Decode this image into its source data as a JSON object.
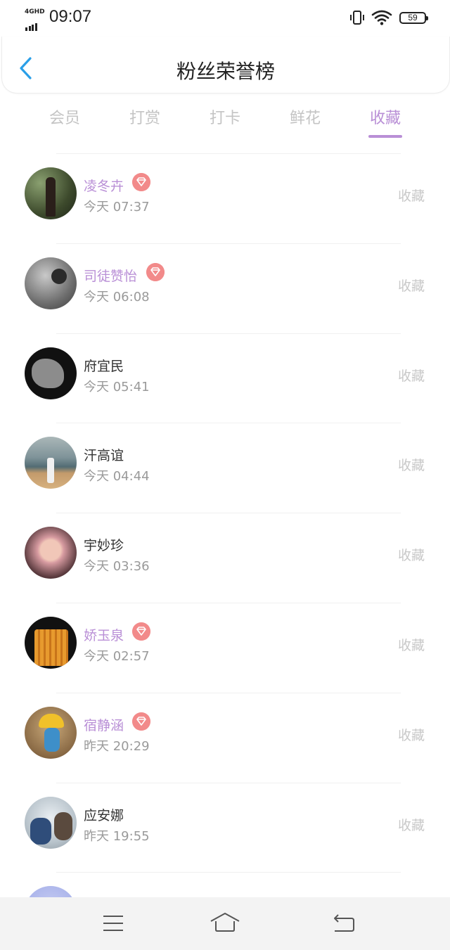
{
  "status_bar": {
    "network": "4GHD",
    "time": "09:07",
    "battery": "59"
  },
  "header": {
    "title": "粉丝荣誉榜"
  },
  "tabs": [
    {
      "label": "会员"
    },
    {
      "label": "打赏"
    },
    {
      "label": "打卡"
    },
    {
      "label": "鲜花"
    },
    {
      "label": "收藏"
    }
  ],
  "active_tab": "收藏",
  "colors": {
    "accent": "#b98fd6",
    "badge": "#f28a8a",
    "back_arrow": "#2a9fe8"
  },
  "rows": [
    {
      "name": "凌冬卉",
      "vip": true,
      "time": "今天 07:37",
      "action": "收藏"
    },
    {
      "name": "司徒赞怡",
      "vip": true,
      "time": "今天 06:08",
      "action": "收藏"
    },
    {
      "name": "府宜民",
      "vip": false,
      "time": "今天 05:41",
      "action": "收藏"
    },
    {
      "name": "汗高谊",
      "vip": false,
      "time": "今天 04:44",
      "action": "收藏"
    },
    {
      "name": "宇妙珍",
      "vip": false,
      "time": "今天 03:36",
      "action": "收藏"
    },
    {
      "name": "娇玉泉",
      "vip": true,
      "time": "今天 02:57",
      "action": "收藏"
    },
    {
      "name": "宿静涵",
      "vip": true,
      "time": "昨天 20:29",
      "action": "收藏"
    },
    {
      "name": "应安娜",
      "vip": false,
      "time": "昨天 19:55",
      "action": "收藏"
    }
  ],
  "nav_icons": [
    "menu-icon",
    "home-icon",
    "back-icon"
  ]
}
